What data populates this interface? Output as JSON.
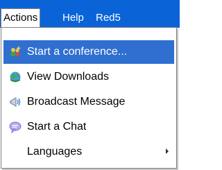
{
  "menubar": {
    "items": [
      {
        "label": "Actions",
        "state": "open"
      },
      {
        "label": "Help"
      },
      {
        "label": "Red5"
      }
    ]
  },
  "dropdown": {
    "items": [
      {
        "label": "Start a conference...",
        "icon": "users-plus-icon",
        "highlighted": true
      },
      {
        "label": "View Downloads",
        "icon": "globe-download-icon"
      },
      {
        "label": "Broadcast Message",
        "icon": "megaphone-icon"
      },
      {
        "label": "Start a Chat",
        "icon": "chat-bubble-icon"
      },
      {
        "label": "Languages",
        "icon": null,
        "has_submenu": true
      }
    ]
  },
  "colors": {
    "menubar_bg": "#0a64d8",
    "highlight_bg": "#2f6fd0",
    "text": "#000000",
    "highlight_text": "#ffffff"
  }
}
